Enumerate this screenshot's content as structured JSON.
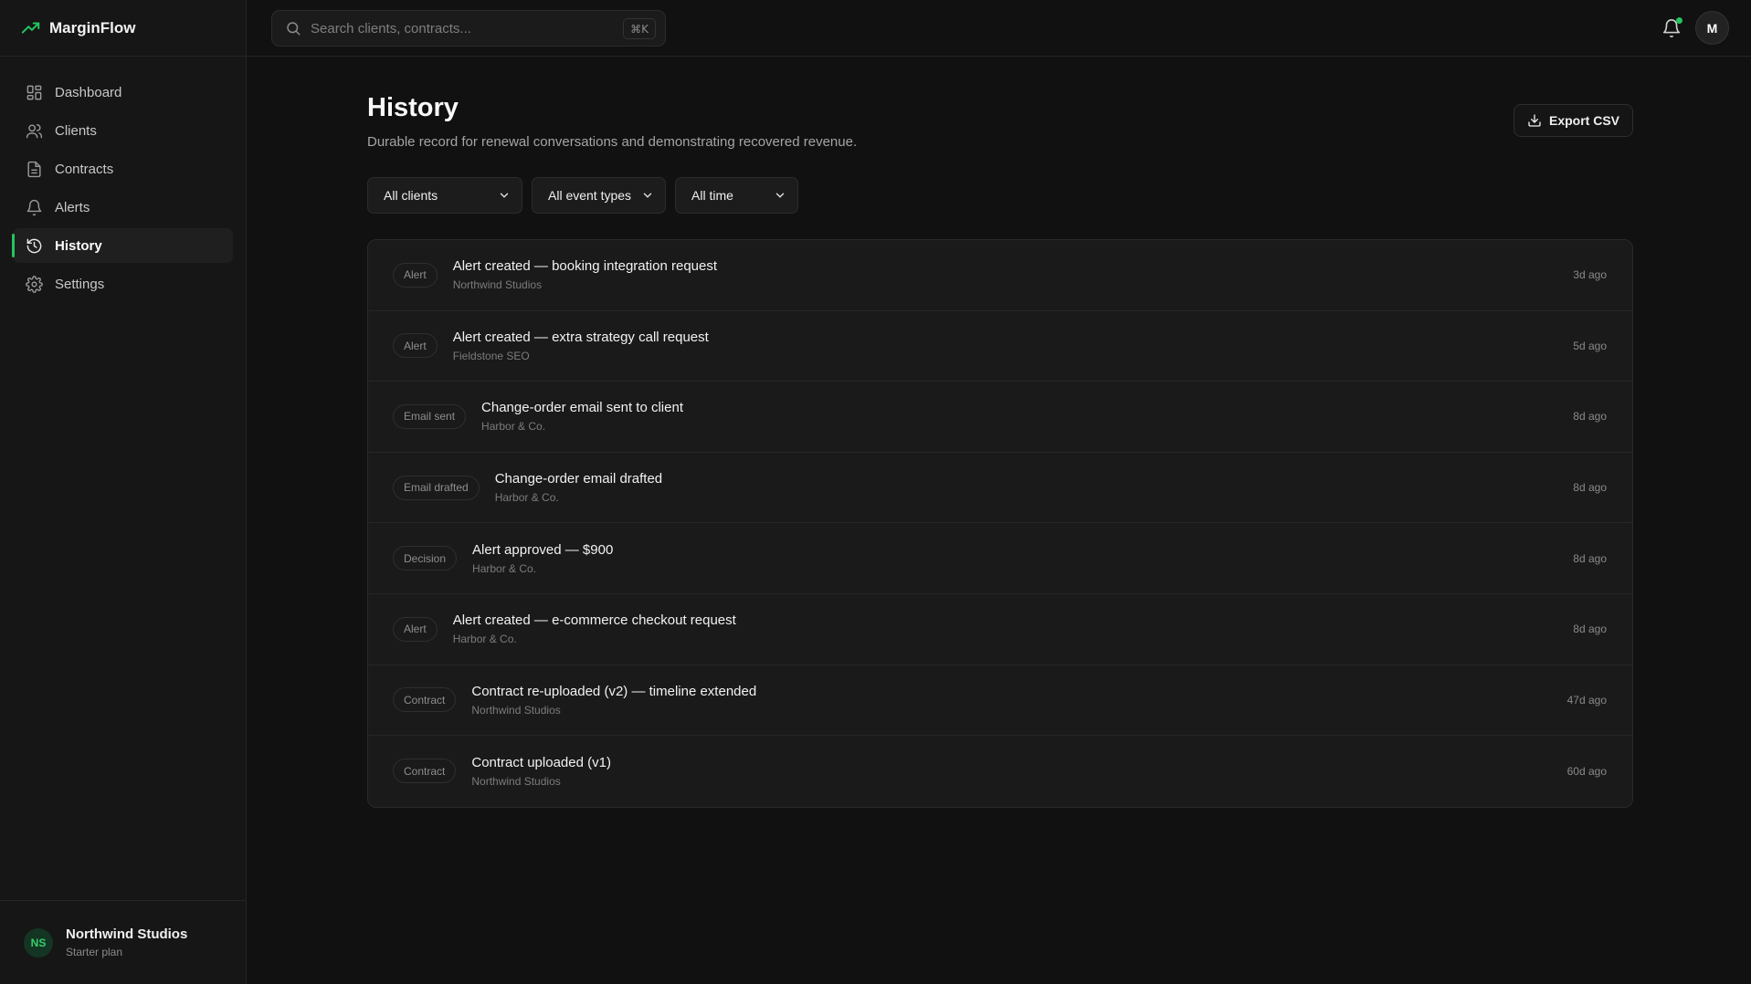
{
  "brand": {
    "name": "MarginFlow",
    "accent": "#22c55e"
  },
  "search": {
    "placeholder": "Search clients, contracts...",
    "shortcut": "⌘K"
  },
  "sidebar": {
    "items": [
      {
        "label": "Dashboard",
        "icon": "grid-icon",
        "active": false
      },
      {
        "label": "Clients",
        "icon": "users-icon",
        "active": false
      },
      {
        "label": "Contracts",
        "icon": "file-text-icon",
        "active": false
      },
      {
        "label": "Alerts",
        "icon": "bell-icon",
        "active": false
      },
      {
        "label": "History",
        "icon": "history-icon",
        "active": true
      },
      {
        "label": "Settings",
        "icon": "gear-icon",
        "active": false
      }
    ]
  },
  "account": {
    "initials": "NS",
    "name": "Northwind Studios",
    "plan": "Starter plan"
  },
  "user": {
    "initial": "M"
  },
  "page": {
    "title": "History",
    "subtitle": "Durable record for renewal conversations and demonstrating recovered revenue.",
    "export_label": "Export CSV"
  },
  "filters": {
    "clients": "All clients",
    "event_types": "All event types",
    "time": "All time"
  },
  "events": [
    {
      "badge": "Alert",
      "title": "Alert created — booking integration request",
      "client": "Northwind Studios",
      "time": "3d ago"
    },
    {
      "badge": "Alert",
      "title": "Alert created — extra strategy call request",
      "client": "Fieldstone SEO",
      "time": "5d ago"
    },
    {
      "badge": "Email sent",
      "title": "Change-order email sent to client",
      "client": "Harbor & Co.",
      "time": "8d ago"
    },
    {
      "badge": "Email drafted",
      "title": "Change-order email drafted",
      "client": "Harbor & Co.",
      "time": "8d ago"
    },
    {
      "badge": "Decision",
      "title": "Alert approved — $900",
      "client": "Harbor & Co.",
      "time": "8d ago"
    },
    {
      "badge": "Alert",
      "title": "Alert created — e-commerce checkout request",
      "client": "Harbor & Co.",
      "time": "8d ago"
    },
    {
      "badge": "Contract",
      "title": "Contract re-uploaded (v2) — timeline extended",
      "client": "Northwind Studios",
      "time": "47d ago"
    },
    {
      "badge": "Contract",
      "title": "Contract uploaded (v1)",
      "client": "Northwind Studios",
      "time": "60d ago"
    }
  ]
}
